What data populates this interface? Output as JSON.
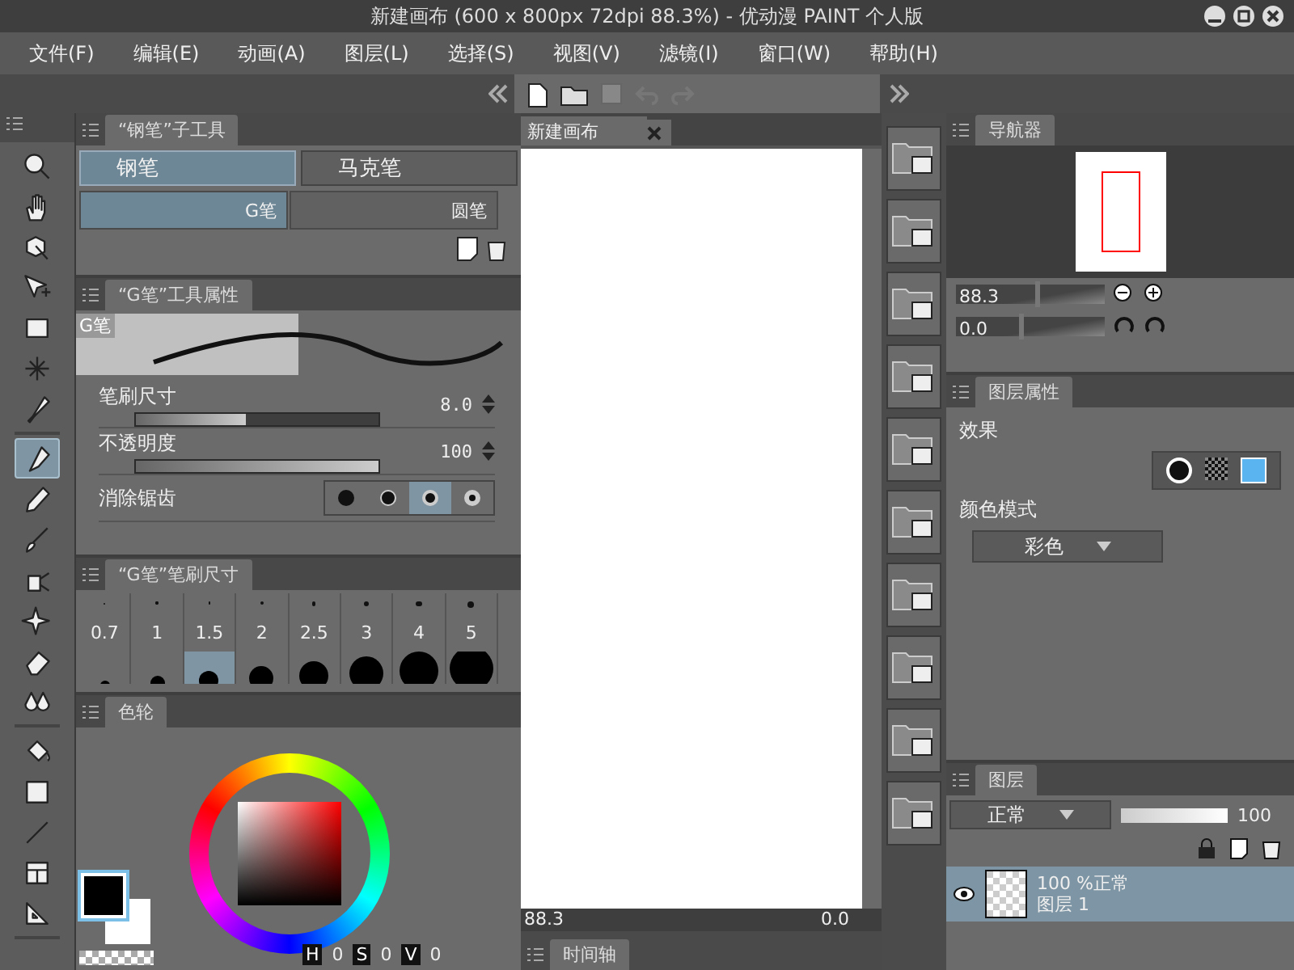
{
  "window": {
    "title": "新建画布 (600 x 800px 72dpi 88.3%)  - 优动漫 PAINT 个人版"
  },
  "menu": [
    "文件(F)",
    "编辑(E)",
    "动画(A)",
    "图层(L)",
    "选择(S)",
    "视图(V)",
    "滤镜(I)",
    "窗口(W)",
    "帮助(H)"
  ],
  "tool_groups": [
    [
      {
        "kind": "zoom",
        "selected": false
      },
      {
        "kind": "hand",
        "selected": false
      },
      {
        "kind": "operation",
        "selected": false
      },
      {
        "kind": "move",
        "selected": false
      },
      {
        "kind": "marquee",
        "selected": false
      },
      {
        "kind": "wand",
        "selected": false
      },
      {
        "kind": "eyedropper",
        "selected": false
      }
    ],
    [
      {
        "kind": "pen",
        "selected": true
      },
      {
        "kind": "pencil",
        "selected": false
      },
      {
        "kind": "brush",
        "selected": false
      },
      {
        "kind": "airbrush",
        "selected": false
      },
      {
        "kind": "sparkle",
        "selected": false
      },
      {
        "kind": "eraser",
        "selected": false
      },
      {
        "kind": "blend",
        "selected": false
      }
    ],
    [
      {
        "kind": "fill",
        "selected": false
      },
      {
        "kind": "gradient",
        "selected": false
      },
      {
        "kind": "line",
        "selected": false
      },
      {
        "kind": "frame",
        "selected": false
      },
      {
        "kind": "ruler",
        "selected": false
      }
    ]
  ],
  "subtool": {
    "tab": "“钢笔”子工具",
    "groups": [
      {
        "label": "钢笔",
        "selected": true
      },
      {
        "label": "马克笔",
        "selected": false
      }
    ],
    "brushes": [
      {
        "label": "G笔",
        "selected": true
      },
      {
        "label": "圆笔",
        "selected": false
      }
    ]
  },
  "tool_property": {
    "tab": "“G笔”工具属性",
    "preview_label": "G笔",
    "rows": [
      {
        "kind": "slider",
        "label": "笔刷尺寸",
        "value": "8.0",
        "level": 0.45
      },
      {
        "kind": "slider",
        "label": "不透明度",
        "value": "100",
        "level": 1
      },
      {
        "kind": "choices",
        "label": "消除锯齿",
        "options": [
          {
            "selected": false
          },
          {
            "selected": false
          },
          {
            "selected": true
          },
          {
            "selected": false
          }
        ]
      }
    ]
  },
  "brush_size": {
    "tab": "“G笔”笔刷尺寸",
    "sizes": [
      {
        "label": "0.7",
        "selected": false
      },
      {
        "label": "1",
        "selected": false
      },
      {
        "label": "1.5",
        "selected": false
      },
      {
        "label": "2",
        "selected": false
      },
      {
        "label": "2.5",
        "selected": false
      },
      {
        "label": "3",
        "selected": false
      },
      {
        "label": "4",
        "selected": false
      },
      {
        "label": "5",
        "selected": false
      }
    ],
    "next_row": [
      {
        "selected": false
      },
      {
        "selected": false
      },
      {
        "selected": true
      },
      {
        "selected": false
      },
      {
        "selected": false
      },
      {
        "selected": false
      },
      {
        "selected": false
      },
      {
        "selected": false
      }
    ]
  },
  "color": {
    "tab": "色轮",
    "readouts": [
      {
        "label": "H",
        "value": "0"
      },
      {
        "label": "S",
        "value": "0"
      },
      {
        "label": "V",
        "value": "0"
      }
    ]
  },
  "canvas": {
    "tab": "新建画布",
    "zoom": "88.3",
    "rotation": "0.0",
    "timeline_tab": "时间轴"
  },
  "navigator": {
    "tab": "导航器",
    "zoom": {
      "value": "88.3",
      "level": 0.55
    },
    "rotation": {
      "value": "0.0",
      "level": 0.45
    }
  },
  "layer_property": {
    "tab": "图层属性",
    "effect_label": "效果",
    "color_mode_label": "颜色模式",
    "color_mode": "彩色"
  },
  "layers": {
    "tab": "图层",
    "blend_mode": "正常",
    "opacity": {
      "value": "100",
      "level": 1
    },
    "items": [
      {
        "opacity_mode": "100 %正常",
        "name": "图层 1",
        "selected": true
      }
    ]
  }
}
